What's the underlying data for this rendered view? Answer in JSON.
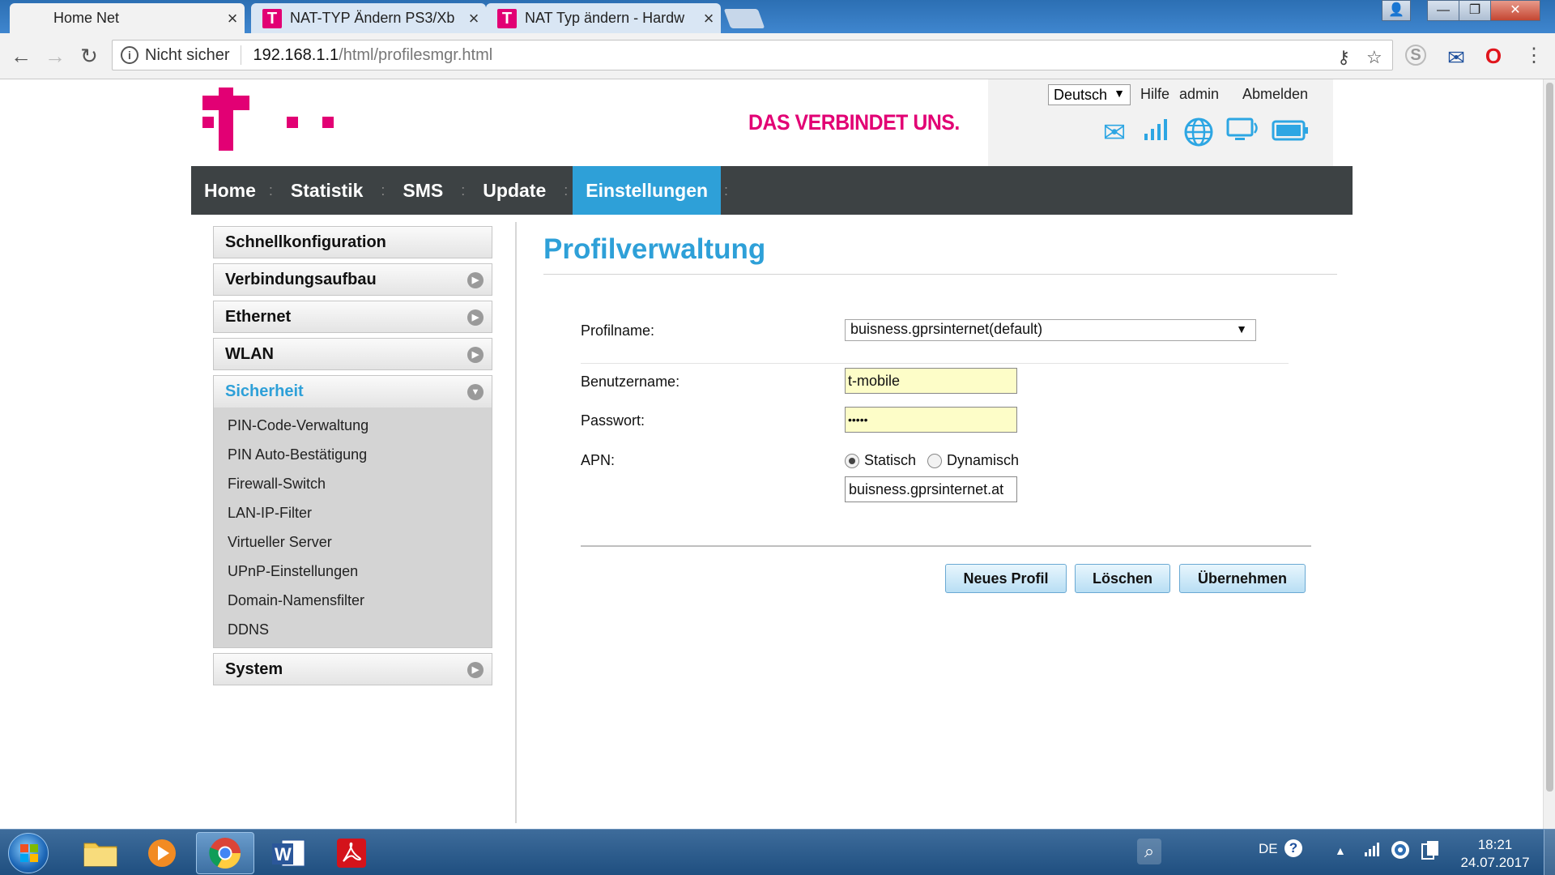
{
  "browser": {
    "tabs": [
      {
        "title": "Home Net",
        "active": true
      },
      {
        "title": "NAT-TYP Ändern PS3/Xb",
        "active": false
      },
      {
        "title": "NAT Typ ändern - Hardw",
        "active": false
      }
    ],
    "tab_icon_letter": "T",
    "close_glyph": "×",
    "security_label": "Nicht sicher",
    "url_host": "192.168.1.1",
    "url_path": "/html/profilesmgr.html",
    "window_buttons": {
      "user": "👤",
      "minimize": "—",
      "restore": "❐",
      "close": "✕"
    }
  },
  "site": {
    "slogan": "DAS VERBINDET UNS.",
    "brand_color": "#e20074",
    "accent_color": "#2ea0d8",
    "language": "Deutsch",
    "links": {
      "help": "Hilfe",
      "user": "admin",
      "logout": "Abmelden"
    },
    "status_icons": [
      "mail-icon",
      "signal-icon",
      "globe-icon",
      "monitor-icon",
      "battery-icon"
    ],
    "nav": [
      {
        "label": "Home",
        "active": false
      },
      {
        "label": "Statistik",
        "active": false
      },
      {
        "label": "SMS",
        "active": false
      },
      {
        "label": "Update",
        "active": false
      },
      {
        "label": "Einstellungen",
        "active": true
      }
    ],
    "sidebar": {
      "items_top": [
        "Schnellkonfiguration",
        "Verbindungsaufbau",
        "Ethernet",
        "WLAN"
      ],
      "open_item": "Sicherheit",
      "sub_items": [
        "PIN-Code-Verwaltung",
        "PIN Auto-Bestätigung",
        "Firewall-Switch",
        "LAN-IP-Filter",
        "Virtueller Server",
        "UPnP-Einstellungen",
        "Domain-Namensfilter",
        "DDNS"
      ],
      "items_bottom": [
        "System"
      ]
    }
  },
  "form": {
    "title": "Profilverwaltung",
    "profile_label": "Profilname:",
    "profile_value": "buisness.gprsinternet(default)",
    "username_label": "Benutzername:",
    "username_value": "t-mobile",
    "password_label": "Passwort:",
    "password_value": "•••••",
    "apn_label": "APN:",
    "apn_static": "Statisch",
    "apn_dynamic": "Dynamisch",
    "apn_mode": "static",
    "apn_value": "buisness.gprsinternet.at",
    "buttons": {
      "new": "Neues Profil",
      "delete": "Löschen",
      "apply": "Übernehmen"
    }
  },
  "taskbar": {
    "apps": [
      "explorer-icon",
      "media-player-icon",
      "chrome-icon",
      "word-icon",
      "acrobat-icon"
    ],
    "language": "DE",
    "time": "18:21",
    "date": "24.07.2017"
  }
}
